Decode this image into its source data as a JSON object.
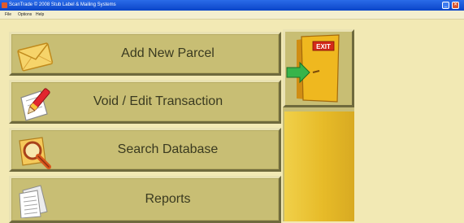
{
  "window": {
    "title": "ScanTrade © 2008 Stub Label & Mailing Systems",
    "minimize_symbol": "_",
    "close_symbol": "✕"
  },
  "menu": [
    "File",
    "Options",
    "Help"
  ],
  "buttons": {
    "add_parcel": {
      "label": "Add New Parcel",
      "icon": "envelope-icon"
    },
    "void_edit": {
      "label": "Void / Edit Transaction",
      "icon": "pen-paper-icon"
    },
    "search_db": {
      "label": "Search Database",
      "icon": "magnifier-icon"
    },
    "reports": {
      "label": "Reports",
      "icon": "documents-icon"
    },
    "exit": {
      "label": "EXIT",
      "icon": "exit-door-icon"
    }
  },
  "colors": {
    "background": "#f2e9b4",
    "button_face": "#c8be74",
    "title_bar": "#0a44c8",
    "exit_door": "#e9b321",
    "exit_sign": "#d42a1a"
  }
}
